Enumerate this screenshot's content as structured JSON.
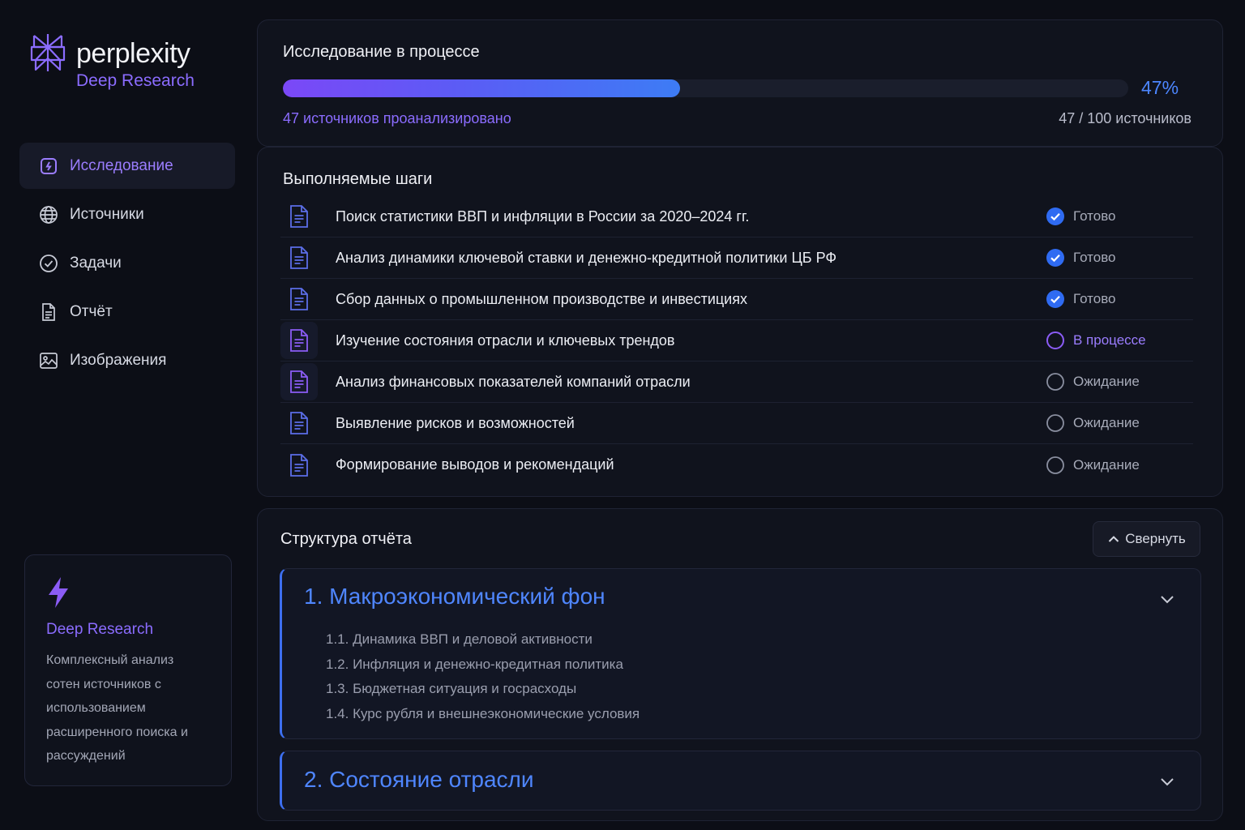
{
  "brand": {
    "name": "perplexity",
    "product": "Deep Research"
  },
  "sidebar": {
    "items": [
      {
        "label": "Исследование",
        "icon": "research-icon",
        "active": true
      },
      {
        "label": "Источники",
        "icon": "globe-icon",
        "active": false
      },
      {
        "label": "Задачи",
        "icon": "check-circle-icon",
        "active": false
      },
      {
        "label": "Отчёт",
        "icon": "document-icon",
        "active": false
      },
      {
        "label": "Изображения",
        "icon": "image-icon",
        "active": false
      }
    ],
    "promo": {
      "icon": "lightning-icon",
      "title": "Deep Research",
      "text": "Комплексный анализ сотен источников с использованием расширенного поиска и рассуждений"
    }
  },
  "progress": {
    "title": "Исследование в процессе",
    "percent_label": "47%",
    "fraction": 0.47,
    "analyzed_label": "47 источников проанализировано",
    "count_label": "47 / 100 источников"
  },
  "steps": {
    "title": "Выполняемые шаги",
    "items": [
      {
        "text": "Поиск статистики ВВП и инфляции в России за 2020–2024 гг.",
        "status": "Готово",
        "state": "done"
      },
      {
        "text": "Анализ динамики ключевой ставки и денежно-кредитной политики ЦБ РФ",
        "status": "Готово",
        "state": "done"
      },
      {
        "text": "Сбор данных о промышленном производстве и инвестициях",
        "status": "Готово",
        "state": "done"
      },
      {
        "text": "Изучение состояния отрасли и ключевых трендов",
        "status": "В процессе",
        "state": "running"
      },
      {
        "text": "Анализ финансовых показателей компаний отрасли",
        "status": "Ожидание",
        "state": "pending"
      },
      {
        "text": "Выявление рисков и возможностей",
        "status": "Ожидание",
        "state": "pending"
      },
      {
        "text": "Формирование выводов и рекомендаций",
        "status": "Ожидание",
        "state": "pending"
      }
    ]
  },
  "report": {
    "title": "Структура отчёта",
    "collapse_label": "Свернуть",
    "sections": [
      {
        "title": "1. Макроэкономический фон",
        "subsections": [
          "1.1. Динамика ВВП и деловой активности",
          "1.2. Инфляция и денежно-кредитная политика",
          "1.3. Бюджетная ситуация и госрасходы",
          "1.4. Курс рубля и внешнеэкономические условия"
        ]
      },
      {
        "title": "2. Состояние отрасли",
        "subsections": []
      }
    ]
  },
  "colors": {
    "accent_purple": "#8b6cff",
    "accent_blue": "#4f86ff",
    "done_blue": "#2f6bf2",
    "background": "#0c0e16"
  }
}
